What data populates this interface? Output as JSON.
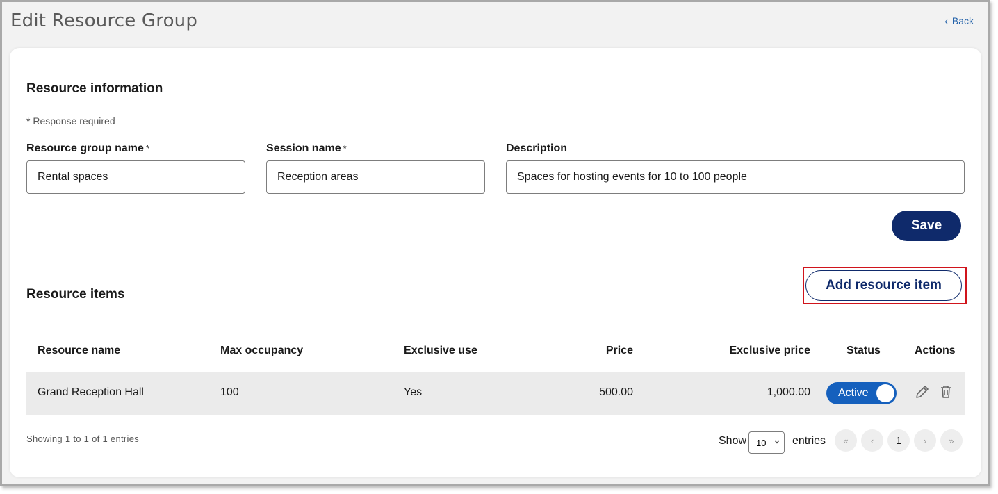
{
  "header": {
    "title": "Edit Resource Group",
    "back_label": "Back"
  },
  "resource_info": {
    "title": "Resource information",
    "required_note": "* Response required",
    "fields": {
      "group_name": {
        "label": "Resource group name",
        "required_mark": "*",
        "value": "Rental spaces"
      },
      "session_name": {
        "label": "Session name",
        "required_mark": "*",
        "value": "Reception areas"
      },
      "description": {
        "label": "Description",
        "value": "Spaces for hosting events for 10 to 100 people"
      }
    },
    "save_label": "Save"
  },
  "resource_items": {
    "title": "Resource items",
    "add_label": "Add resource item",
    "highlight_color": "#d0141c",
    "columns": {
      "name": "Resource name",
      "max_occupancy": "Max occupancy",
      "exclusive_use": "Exclusive use",
      "price": "Price",
      "exclusive_price": "Exclusive price",
      "status": "Status",
      "actions": "Actions"
    },
    "rows": [
      {
        "name": "Grand Reception Hall",
        "max_occupancy": "100",
        "exclusive_use": "Yes",
        "price": "500.00",
        "exclusive_price": "1,000.00",
        "status": "Active",
        "status_on": true,
        "actions": [
          "pencil-icon",
          "trash-icon"
        ]
      }
    ],
    "footer": {
      "info": "Showing 1 to 1 of 1 entries",
      "show_label": "Show",
      "entries_value": "10",
      "entries_label": "entries",
      "pagination": {
        "first": "«",
        "prev": "‹",
        "current": "1",
        "next": "›",
        "last": "»"
      }
    }
  },
  "colors": {
    "primary": "#0f2a6b",
    "toggle": "#1560bd",
    "link": "#1f5fa8"
  }
}
